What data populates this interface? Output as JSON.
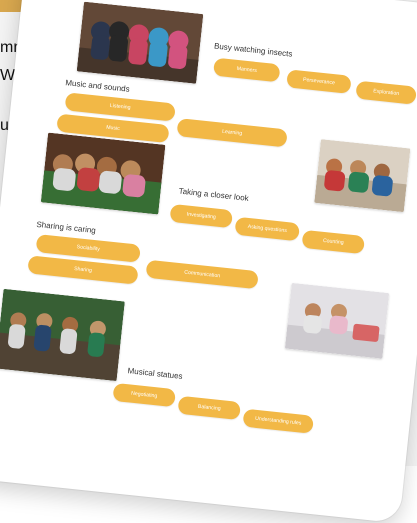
{
  "background_text": {
    "line1": "mmer",
    "line2": "Whe",
    "line3": "ucat"
  },
  "sections": [
    {
      "title": "Busy watching insects",
      "tags": [
        "Manners",
        "Perseverance",
        "Exploration"
      ]
    },
    {
      "title": "Music and sounds",
      "tags": [
        "Listening",
        "Learning",
        "Music"
      ]
    },
    {
      "title": "Taking a closer look",
      "tags": [
        "Investigating",
        "Asking questions",
        "Counting"
      ]
    },
    {
      "title": "Sharing is caring",
      "tags": [
        "Sociability",
        "Communication",
        "Sharing"
      ]
    },
    {
      "title": "Musical statues",
      "tags": [
        "Negotiating",
        "Balancing",
        "Understanding rules"
      ]
    }
  ]
}
